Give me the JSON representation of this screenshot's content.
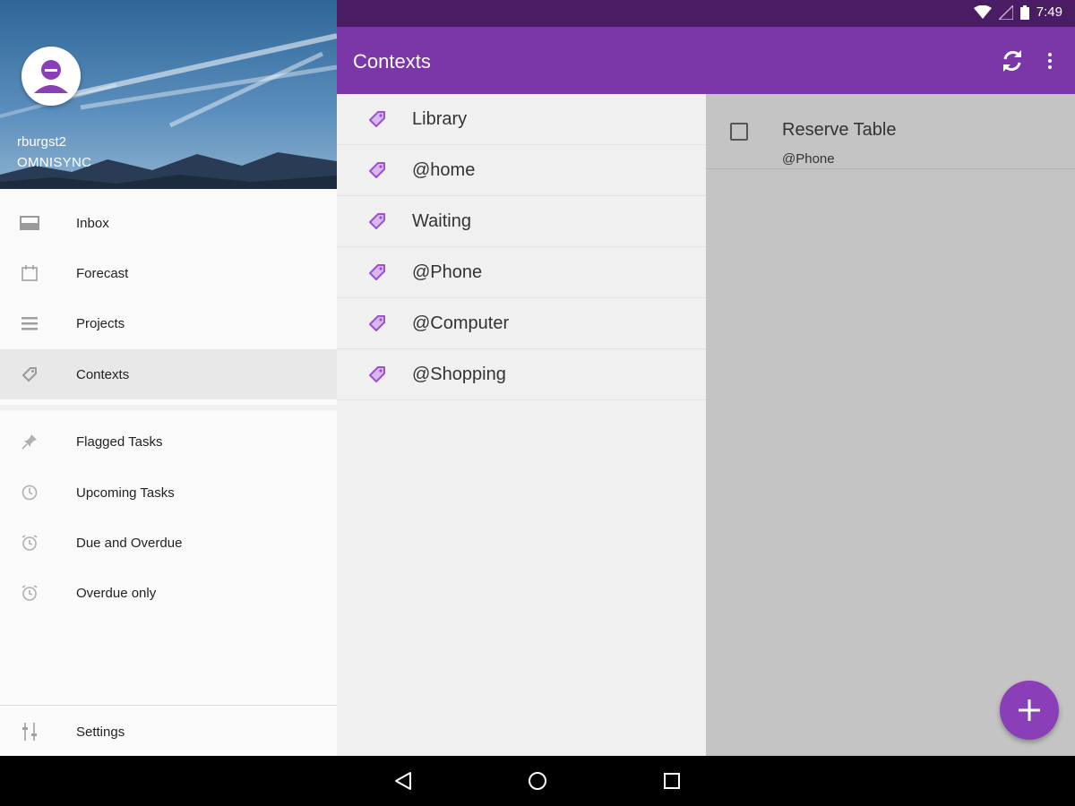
{
  "status_bar": {
    "time": "7:49"
  },
  "drawer": {
    "account_name": "rburgst2",
    "account_service": "OMNISYNC",
    "items": [
      {
        "label": "Inbox",
        "icon": "inbox-icon"
      },
      {
        "label": "Forecast",
        "icon": "calendar-icon"
      },
      {
        "label": "Projects",
        "icon": "list-icon"
      },
      {
        "label": "Contexts",
        "icon": "tag-icon",
        "selected": true
      },
      {
        "label": "Flagged Tasks",
        "icon": "pin-icon"
      },
      {
        "label": "Upcoming Tasks",
        "icon": "clock-icon"
      },
      {
        "label": "Due and Overdue",
        "icon": "alarm-icon"
      },
      {
        "label": "Overdue only",
        "icon": "alarm-icon"
      },
      {
        "label": "Settings",
        "icon": "sliders-icon"
      }
    ]
  },
  "appbar": {
    "title": "Contexts"
  },
  "contexts": [
    {
      "label": "Library"
    },
    {
      "label": "@home"
    },
    {
      "label": "Waiting"
    },
    {
      "label": "@Phone"
    },
    {
      "label": "@Computer"
    },
    {
      "label": "@Shopping"
    }
  ],
  "tasks": [
    {
      "title": "Reserve Table",
      "context": "@Phone"
    }
  ],
  "colors": {
    "accent": "#7b37a8",
    "status_bar": "#4a1c63",
    "fab": "#8a3fb8",
    "tag_icon": "#a04fd0"
  }
}
